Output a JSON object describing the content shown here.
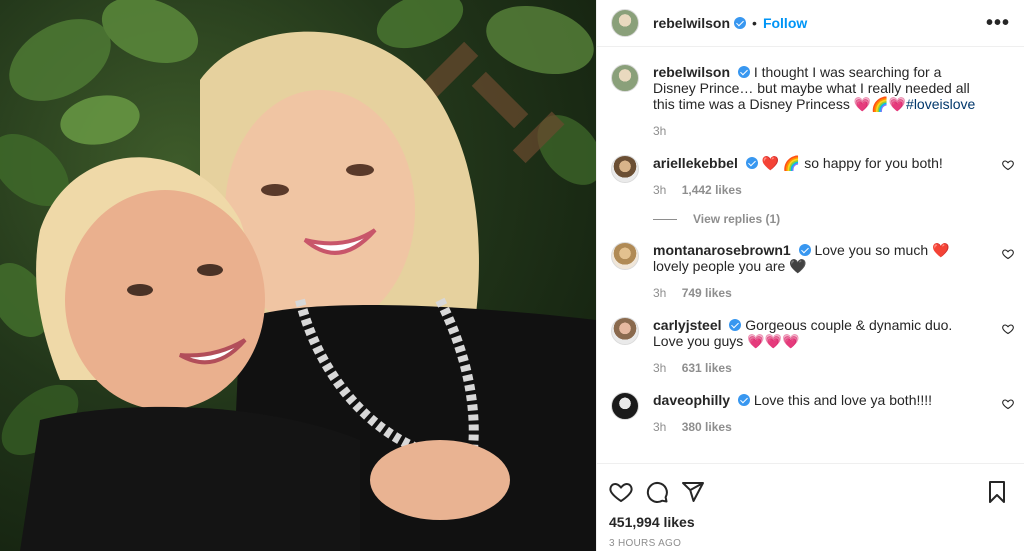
{
  "post": {
    "author": "rebelwilson",
    "follow_label": "Follow",
    "dot": "•",
    "more_label": "•••",
    "caption_author": "rebelwilson",
    "caption_text": "I thought I was searching for a Disney Prince… but maybe what I really needed all this time was a Disney Princess 💗🌈💗",
    "caption_hashtag": "#loveislove",
    "caption_time": "3h",
    "likes": "451,994 likes",
    "time_ago": "3 HOURS AGO"
  },
  "comments": [
    {
      "user": "ariellekebbel",
      "text": "❤️ 🌈 so happy for you both!",
      "time": "3h",
      "likes": "1,442 likes",
      "view_replies": "View replies (1)"
    },
    {
      "user": "montanarosebrown1",
      "text": "Love you so much ❤️ lovely people you are 🖤",
      "time": "3h",
      "likes": "749 likes"
    },
    {
      "user": "carlyjsteel",
      "text": "Gorgeous couple & dynamic duo. Love you guys 💗💗💗",
      "time": "3h",
      "likes": "631 likes"
    },
    {
      "user": "daveophilly",
      "text": "Love this and love ya both!!!!",
      "time": "3h",
      "likes": "380 likes"
    }
  ],
  "colors": {
    "accent": "#0095f6",
    "verified": "#3897f0",
    "muted": "#8e8e8e",
    "hashtag": "#00376b"
  },
  "icons": [
    "verified-badge-icon",
    "heart-icon",
    "comment-icon",
    "share-icon",
    "bookmark-icon",
    "more-options-icon"
  ]
}
